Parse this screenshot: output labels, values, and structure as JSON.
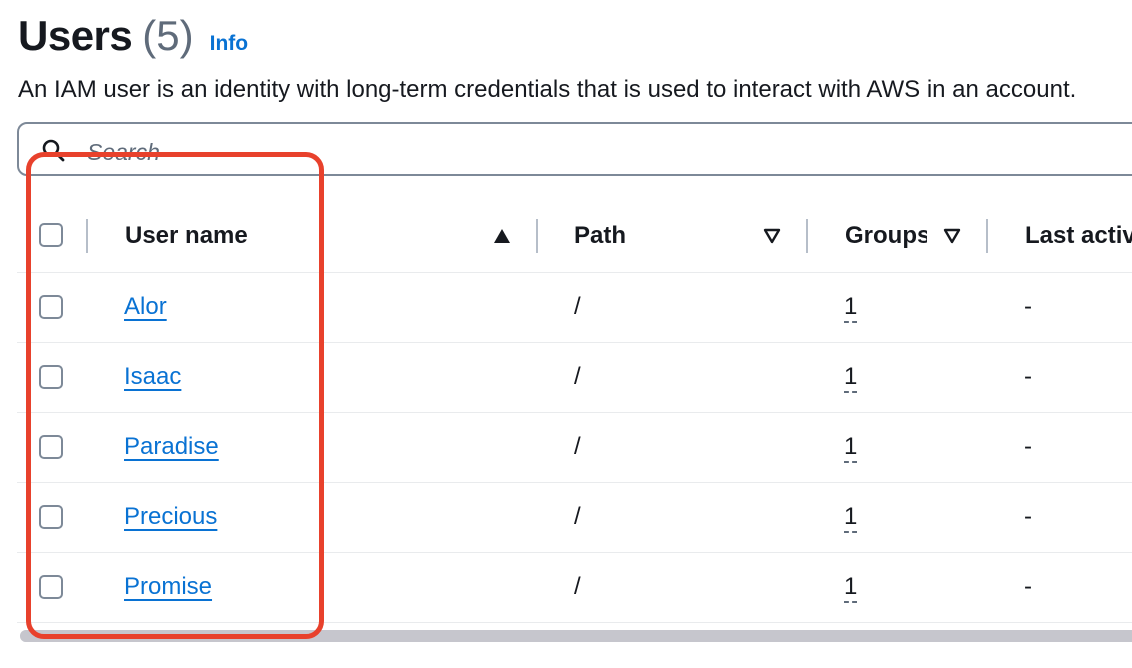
{
  "header": {
    "title": "Users",
    "count": "(5)",
    "info_link": "Info",
    "description": "An IAM user is an identity with long-term credentials that is used to interact with AWS in an account."
  },
  "search": {
    "placeholder": "Search",
    "value": ""
  },
  "table": {
    "columns": [
      {
        "label": "User name",
        "sort": "ascending"
      },
      {
        "label": "Path",
        "sort": "none"
      },
      {
        "label": "Groups",
        "sort": "none"
      },
      {
        "label": "Last activity",
        "sort": "none"
      }
    ],
    "rows": [
      {
        "user_name": "Alor",
        "path": "/",
        "groups": "1",
        "last_activity": "-"
      },
      {
        "user_name": "Isaac",
        "path": "/",
        "groups": "1",
        "last_activity": "-"
      },
      {
        "user_name": "Paradise",
        "path": "/",
        "groups": "1",
        "last_activity": "-"
      },
      {
        "user_name": "Precious",
        "path": "/",
        "groups": "1",
        "last_activity": "-"
      },
      {
        "user_name": "Promise",
        "path": "/",
        "groups": "1",
        "last_activity": "-"
      }
    ]
  },
  "colors": {
    "link": "#0972d3",
    "highlight": "#e8412c",
    "text": "#16191f",
    "secondary": "#5f6b7a"
  }
}
